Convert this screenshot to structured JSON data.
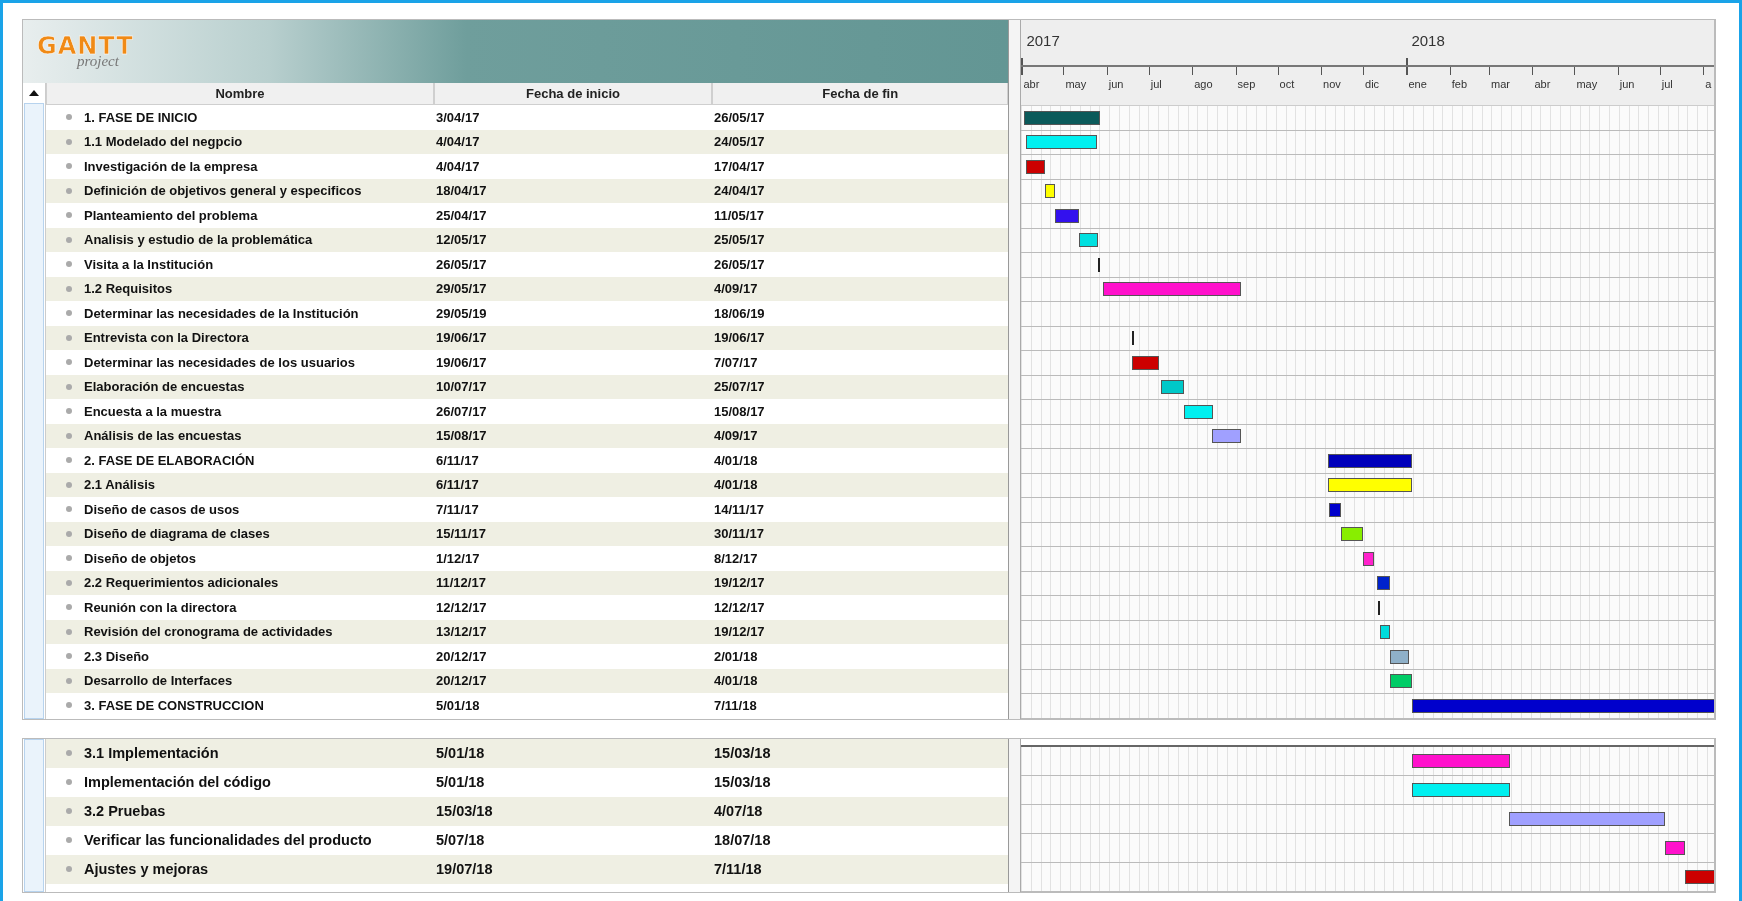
{
  "logo": {
    "title": "GANTT",
    "subtitle": "project"
  },
  "columns": [
    "Nombre",
    "Fecha de inicio",
    "Fecha de fin"
  ],
  "months": [
    {
      "label": "abr",
      "year": "2017"
    },
    {
      "label": "may"
    },
    {
      "label": "jun"
    },
    {
      "label": "jul"
    },
    {
      "label": "ago"
    },
    {
      "label": "sep"
    },
    {
      "label": "oct"
    },
    {
      "label": "nov"
    },
    {
      "label": "dic"
    },
    {
      "label": "ene",
      "year": "2018"
    },
    {
      "label": "feb"
    },
    {
      "label": "mar"
    },
    {
      "label": "abr"
    },
    {
      "label": "may"
    },
    {
      "label": "jun"
    },
    {
      "label": "jul"
    },
    {
      "label": "a"
    }
  ],
  "tasks": [
    {
      "name": "1. FASE DE INICIO",
      "start": "3/04/17",
      "end": "26/05/17",
      "color": "#0b5a5a"
    },
    {
      "name": "1.1 Modelado del negpcio",
      "start": "4/04/17",
      "end": "24/05/17",
      "color": "#00f0f0"
    },
    {
      "name": "Investigación de la empresa",
      "start": "4/04/17",
      "end": "17/04/17",
      "color": "#cc0000"
    },
    {
      "name": "Definición de objetivos general y especificos",
      "start": "18/04/17",
      "end": "24/04/17",
      "color": "#ffff00"
    },
    {
      "name": "Planteamiento del problema",
      "start": "25/04/17",
      "end": "11/05/17",
      "color": "#3311ee"
    },
    {
      "name": "Analisis y estudio de la problemática",
      "start": "12/05/17",
      "end": "25/05/17",
      "color": "#00e0e0"
    },
    {
      "name": "Visita a la Institución",
      "start": "26/05/17",
      "end": "26/05/17"
    },
    {
      "name": "1.2 Requisitos",
      "start": "29/05/17",
      "end": "4/09/17",
      "color": "#ff11cc"
    },
    {
      "name": "Determinar las necesidades de la Institución",
      "start": "29/05/19",
      "end": "18/06/19"
    },
    {
      "name": "Entrevista con la Directora",
      "start": "19/06/17",
      "end": "19/06/17"
    },
    {
      "name": "Determinar las necesidades de los usuarios",
      "start": "19/06/17",
      "end": "7/07/17",
      "color": "#cc0000"
    },
    {
      "name": "Elaboración de encuestas",
      "start": "10/07/17",
      "end": "25/07/17",
      "color": "#00c8c8"
    },
    {
      "name": "Encuesta a la muestra",
      "start": "26/07/17",
      "end": "15/08/17",
      "color": "#00f0f0"
    },
    {
      "name": "Análisis de las encuestas",
      "start": "15/08/17",
      "end": "4/09/17",
      "color": "#a0a0ff"
    },
    {
      "name": "2. FASE DE ELABORACIÓN",
      "start": "6/11/17",
      "end": "4/01/18",
      "color": "#0000bb"
    },
    {
      "name": "2.1 Análisis",
      "start": "6/11/17",
      "end": "4/01/18",
      "color": "#ffff00"
    },
    {
      "name": "Diseño de casos de usos",
      "start": "7/11/17",
      "end": "14/11/17",
      "color": "#0000cc"
    },
    {
      "name": "Diseño de diagrama de clases",
      "start": "15/11/17",
      "end": "30/11/17",
      "color": "#88ee00"
    },
    {
      "name": "Diseño de objetos",
      "start": "1/12/17",
      "end": "8/12/17",
      "color": "#ff22cc"
    },
    {
      "name": "2.2 Requerimientos adicionales",
      "start": "11/12/17",
      "end": "19/12/17",
      "color": "#0022cc"
    },
    {
      "name": "Reunión con la directora",
      "start": "12/12/17",
      "end": "12/12/17"
    },
    {
      "name": "Revisión del cronograma de actividades",
      "start": "13/12/17",
      "end": "19/12/17",
      "color": "#00dddd"
    },
    {
      "name": "2.3 Diseño",
      "start": "20/12/17",
      "end": "2/01/18",
      "color": "#8fb0c8"
    },
    {
      "name": "Desarrollo de Interfaces",
      "start": "20/12/17",
      "end": "4/01/18",
      "color": "#00cc66"
    },
    {
      "name": "3. FASE DE CONSTRUCCION",
      "start": "5/01/18",
      "end": "7/11/18",
      "color": "#0000cc"
    }
  ],
  "tasks_continued": [
    {
      "name": "3.1 Implementación",
      "start": "5/01/18",
      "end": "15/03/18",
      "color": "#ff11cc"
    },
    {
      "name": "Implementación del código",
      "start": "5/01/18",
      "end": "15/03/18",
      "color": "#00f0f0"
    },
    {
      "name": "3.2 Pruebas",
      "start": "15/03/18",
      "end": "4/07/18",
      "color": "#a0a0ff"
    },
    {
      "name": "Verificar las funcionalidades del producto",
      "start": "5/07/18",
      "end": "18/07/18",
      "color": "#ff11cc"
    },
    {
      "name": "Ajustes y mejoras",
      "start": "19/07/18",
      "end": "7/11/18",
      "color": "#cc0000"
    }
  ]
}
